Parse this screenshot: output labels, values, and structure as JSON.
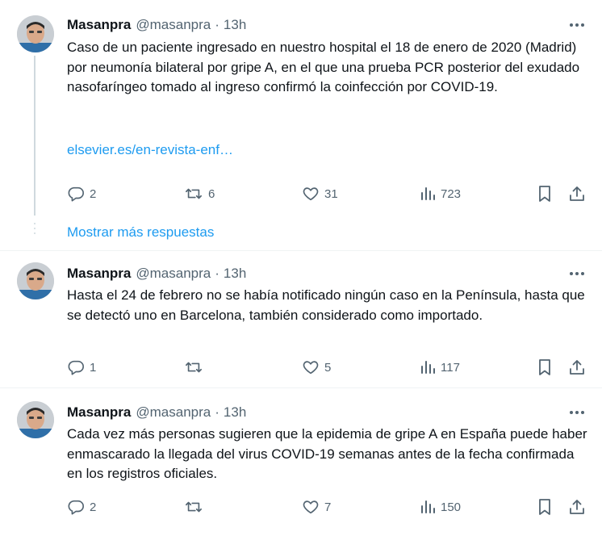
{
  "tweets": [
    {
      "name": "Masanpra",
      "handle": "@masanpra",
      "dot": "·",
      "time": "13h",
      "text": "Caso de un paciente ingresado en nuestro hospital el 18 de enero de 2020 (Madrid) por neumonía bilateral por gripe A, en el que una prueba PCR posterior del exudado nasofaríngeo tomado al ingreso confirmó la coinfección por COVID-19.",
      "link": "elsevier.es/en-revista-enf…",
      "replies": "2",
      "retweets": "6",
      "likes": "31",
      "views": "723"
    },
    {
      "name": "Masanpra",
      "handle": "@masanpra",
      "dot": "·",
      "time": "13h",
      "text": "Hasta el 24 de febrero no se había notificado ningún caso en la Península, hasta que se detectó uno en Barcelona, también considerado como importado.",
      "replies": "1",
      "retweets": "",
      "likes": "5",
      "views": "117"
    },
    {
      "name": "Masanpra",
      "handle": "@masanpra",
      "dot": "·",
      "time": "13h",
      "text": "Cada vez más personas sugieren que la epidemia de gripe A en España puede haber enmascarado la llegada del virus COVID-19 semanas antes de la fecha confirmada en los registros oficiales.",
      "replies": "2",
      "retweets": "",
      "likes": "7",
      "views": "150"
    }
  ],
  "show_more_label": "Mostrar más respuestas",
  "colors": {
    "link": "#1d9bf0",
    "secondary": "#536471",
    "text": "#0f1419",
    "thread_line": "#cfd9de"
  },
  "icons": [
    "more-icon",
    "reply-icon",
    "retweet-icon",
    "like-icon",
    "views-icon",
    "bookmark-icon",
    "share-icon"
  ]
}
